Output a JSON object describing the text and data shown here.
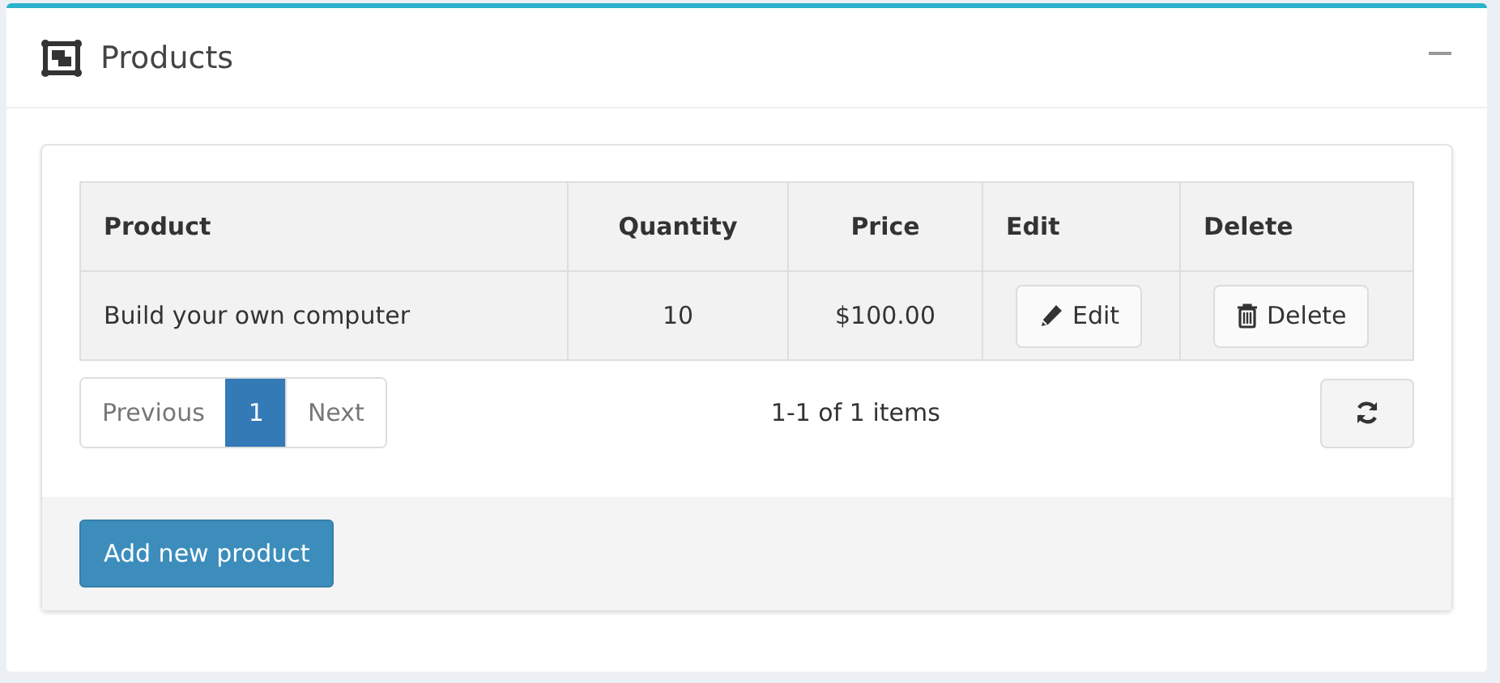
{
  "panel": {
    "title": "Products"
  },
  "table": {
    "columns": [
      {
        "label": "Product"
      },
      {
        "label": "Quantity"
      },
      {
        "label": "Price"
      },
      {
        "label": "Edit"
      },
      {
        "label": "Delete"
      }
    ],
    "rows": [
      {
        "product": "Build your own computer",
        "quantity": "10",
        "price": "$100.00",
        "edit": "Edit",
        "delete": "Delete"
      }
    ]
  },
  "pager": {
    "items": [
      {
        "label": "Previous",
        "selected": false
      },
      {
        "label": "1",
        "selected": true
      },
      {
        "label": "Next",
        "selected": false
      }
    ],
    "summary": "1-1 of 1 items"
  },
  "footer": {
    "button": "Add new product"
  }
}
